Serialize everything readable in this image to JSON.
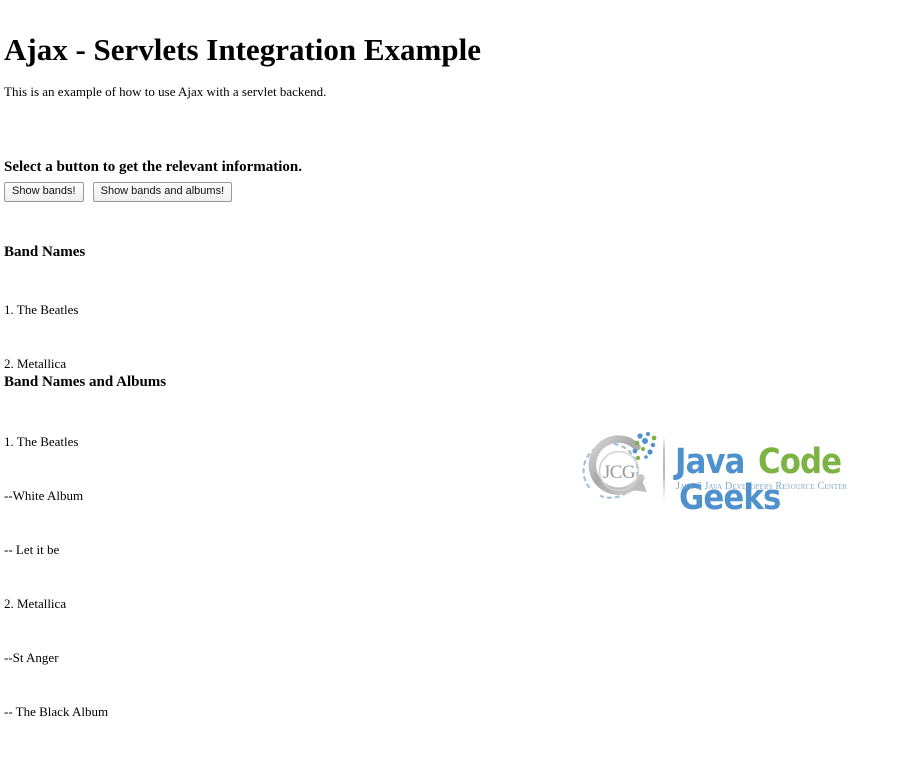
{
  "page": {
    "title": "Ajax - Servlets Integration Example",
    "intro": "This is an example of how to use Ajax with a servlet backend.",
    "background_color": "#ffffff",
    "text_color": "#000000"
  },
  "prompt": {
    "heading": "Select a button to get the relevant information."
  },
  "buttons": [
    {
      "label": "Show bands!",
      "name": "show-bands-button"
    },
    {
      "label": "Show bands and albums!",
      "name": "show-bands-and-albums-button"
    }
  ],
  "bands_section": {
    "heading": "Band Names",
    "lines": [
      "1. The Beatles",
      "2. Metallica"
    ]
  },
  "albums_section": {
    "heading": "Band Names and Albums",
    "lines": [
      "1. The Beatles",
      "--White Album",
      "-- Let it be",
      "2. Metallica",
      "--St Anger",
      "-- The Black Album"
    ]
  },
  "logo": {
    "mark_text": "JCG",
    "word_1": "Java",
    "word_2": "Code",
    "word_3": "Geeks",
    "tagline": "Java 2 Java Developers Resource Center",
    "blue": "#4e91cd",
    "green": "#7cb342",
    "gray": "#b5b5b5"
  }
}
